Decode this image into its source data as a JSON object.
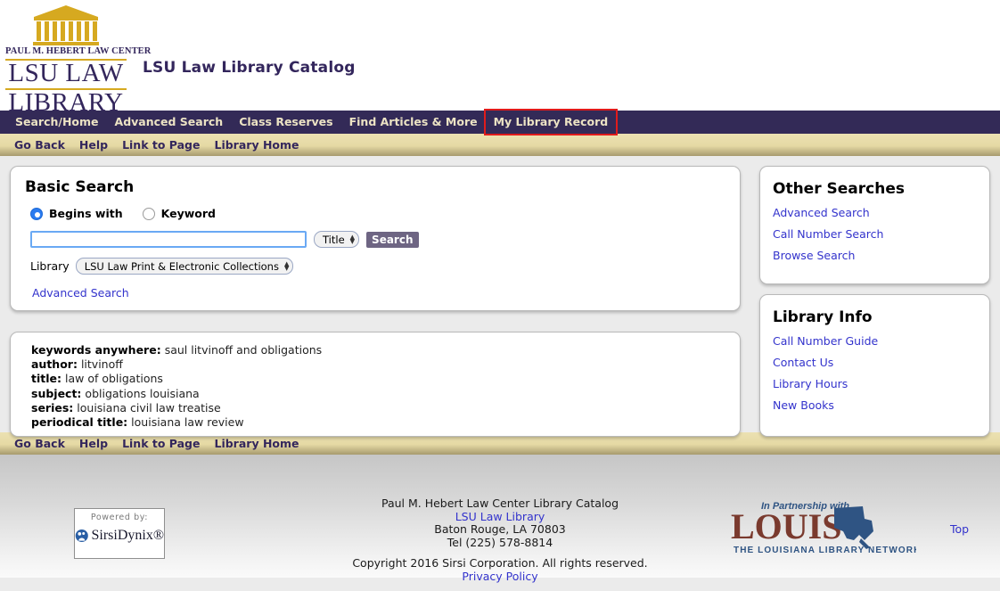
{
  "header": {
    "logo": {
      "building_icon": "classical-law-building",
      "sub_line": "PAUL M. HEBERT LAW CENTER",
      "line1": "LSU LAW",
      "line2": "LIBRARY"
    },
    "site_title": "LSU Law Library Catalog"
  },
  "nav": {
    "items": [
      {
        "label": "Search/Home",
        "highlighted": false
      },
      {
        "label": "Advanced Search",
        "highlighted": false
      },
      {
        "label": "Class Reserves",
        "highlighted": false
      },
      {
        "label": "Find Articles & More",
        "highlighted": false
      },
      {
        "label": "My Library Record",
        "highlighted": true
      }
    ],
    "highlight_color": "#e01b1b"
  },
  "subnav": {
    "items": [
      "Go Back",
      "Help",
      "Link to Page",
      "Library Home"
    ]
  },
  "search_panel": {
    "title": "Basic Search",
    "radios": [
      {
        "label": "Begins with",
        "selected": true
      },
      {
        "label": "Keyword",
        "selected": false
      }
    ],
    "query_value": "",
    "query_placeholder": "",
    "field_select": {
      "value": "Title"
    },
    "search_button": "Search",
    "library_label": "Library",
    "library_select": {
      "value": "LSU Law Print & Electronic Collections"
    },
    "advanced_link": "Advanced Search"
  },
  "examples": {
    "rows": [
      {
        "label": "keywords anywhere:",
        "value": "saul litvinoff and obligations"
      },
      {
        "label": "author:",
        "value": "litvinoff"
      },
      {
        "label": "title:",
        "value": "law of obligations"
      },
      {
        "label": "subject:",
        "value": "obligations louisiana"
      },
      {
        "label": "series:",
        "value": "louisiana civil law treatise"
      },
      {
        "label": "periodical title:",
        "value": "louisiana law review"
      }
    ]
  },
  "other_searches": {
    "title": "Other Searches",
    "links": [
      "Advanced Search",
      "Call Number Search",
      "Browse Search"
    ]
  },
  "library_info": {
    "title": "Library Info",
    "links": [
      "Call Number Guide",
      "Contact Us",
      "Library Hours",
      "New Books"
    ]
  },
  "footer_nav": {
    "items": [
      "Go Back",
      "Help",
      "Link to Page",
      "Library Home"
    ]
  },
  "footer": {
    "sirsi": {
      "powered_by": "Powered by:",
      "name": "SirsiDynix®"
    },
    "line1": "Paul M. Hebert Law Center Library Catalog",
    "link1": "LSU Law Library",
    "line2": "Baton Rouge, LA 70803",
    "line3": "Tel (225) 578-8814",
    "copyright": "Copyright 2016 Sirsi Corporation. All rights reserved.",
    "privacy": "Privacy Policy",
    "louis": {
      "partnership": "In Partnership with",
      "name": "LOUIS",
      "tagline": "THE LOUISIANA LIBRARY NETWORK"
    },
    "top_link": "Top"
  },
  "colors": {
    "nav_bg": "#332a57",
    "nav_text": "#ece3c4",
    "subnav_bg": "#e5d9a4",
    "brand_purple": "#33265c",
    "brand_gold": "#d6a920",
    "link_blue": "#3333cc",
    "page_bg": "#ebebeb",
    "louis_brown": "#7a3a2e",
    "louis_blue": "#2f5483"
  }
}
